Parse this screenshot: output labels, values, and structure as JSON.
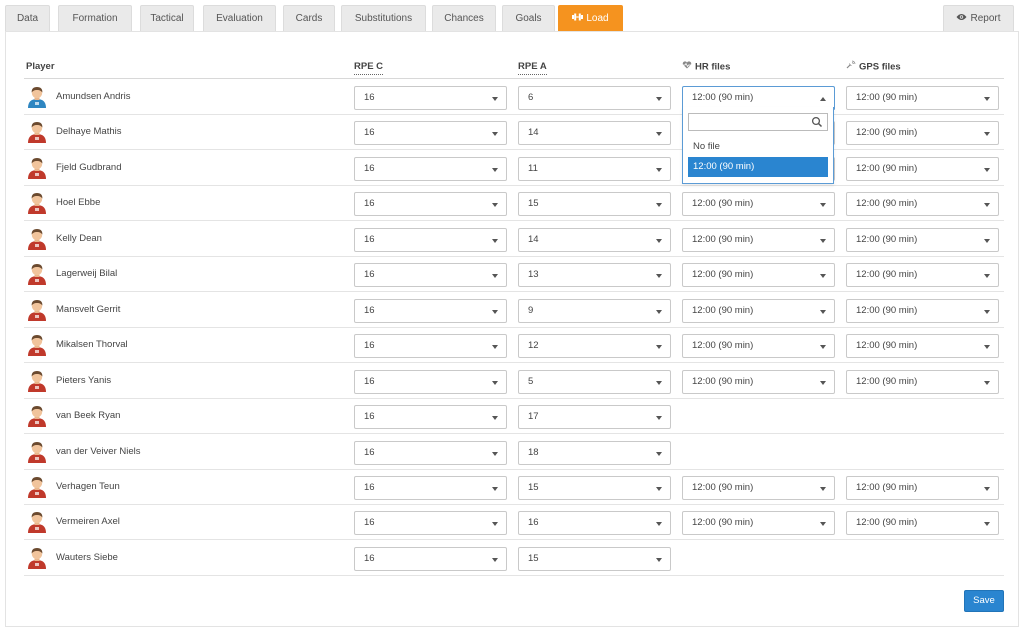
{
  "tabs": [
    {
      "label": "Data",
      "active": false
    },
    {
      "label": "Formation",
      "active": false
    },
    {
      "label": "Tactical",
      "active": false
    },
    {
      "label": "Evaluation",
      "active": false
    },
    {
      "label": "Cards",
      "active": false
    },
    {
      "label": "Substitutions",
      "active": false
    },
    {
      "label": "Chances",
      "active": false
    },
    {
      "label": "Goals",
      "active": false
    },
    {
      "label": "Load",
      "active": true,
      "icon": "dumbbell-icon"
    }
  ],
  "report_tab": {
    "label": "Report",
    "icon": "eye-icon"
  },
  "table": {
    "headers": {
      "player": "Player",
      "rpe_c": "RPE C",
      "rpe_a": "RPE A",
      "hr_files": "HR files",
      "gps_files": "GPS files"
    },
    "rows": [
      {
        "name": "Amundsen Andris",
        "rpe_c": "16",
        "rpe_a": "6",
        "hr": "12:00 (90 min)",
        "gps": "12:00 (90 min)",
        "avatar": "keeper"
      },
      {
        "name": "Delhaye Mathis",
        "rpe_c": "16",
        "rpe_a": "14",
        "hr": "12:00 (90 min)",
        "gps": "12:00 (90 min)",
        "avatar": "player"
      },
      {
        "name": "Fjeld Gudbrand",
        "rpe_c": "16",
        "rpe_a": "11",
        "hr": "12:00 (90 min)",
        "gps": "12:00 (90 min)",
        "avatar": "player"
      },
      {
        "name": "Hoel Ebbe",
        "rpe_c": "16",
        "rpe_a": "15",
        "hr": "12:00 (90 min)",
        "gps": "12:00 (90 min)",
        "avatar": "player"
      },
      {
        "name": "Kelly Dean",
        "rpe_c": "16",
        "rpe_a": "14",
        "hr": "12:00 (90 min)",
        "gps": "12:00 (90 min)",
        "avatar": "player"
      },
      {
        "name": "Lagerweij Bilal",
        "rpe_c": "16",
        "rpe_a": "13",
        "hr": "12:00 (90 min)",
        "gps": "12:00 (90 min)",
        "avatar": "player"
      },
      {
        "name": "Mansvelt Gerrit",
        "rpe_c": "16",
        "rpe_a": "9",
        "hr": "12:00 (90 min)",
        "gps": "12:00 (90 min)",
        "avatar": "player"
      },
      {
        "name": "Mikalsen Thorval",
        "rpe_c": "16",
        "rpe_a": "12",
        "hr": "12:00 (90 min)",
        "gps": "12:00 (90 min)",
        "avatar": "player"
      },
      {
        "name": "Pieters Yanis",
        "rpe_c": "16",
        "rpe_a": "5",
        "hr": "12:00 (90 min)",
        "gps": "12:00 (90 min)",
        "avatar": "player"
      },
      {
        "name": "van Beek Ryan",
        "rpe_c": "16",
        "rpe_a": "17",
        "hr": null,
        "gps": null,
        "avatar": "player"
      },
      {
        "name": "van der Veiver Niels",
        "rpe_c": "16",
        "rpe_a": "18",
        "hr": null,
        "gps": null,
        "avatar": "player"
      },
      {
        "name": "Verhagen Teun",
        "rpe_c": "16",
        "rpe_a": "15",
        "hr": "12:00 (90 min)",
        "gps": "12:00 (90 min)",
        "avatar": "player"
      },
      {
        "name": "Vermeiren Axel",
        "rpe_c": "16",
        "rpe_a": "16",
        "hr": "12:00 (90 min)",
        "gps": "12:00 (90 min)",
        "avatar": "player"
      },
      {
        "name": "Wauters Siebe",
        "rpe_c": "16",
        "rpe_a": "15",
        "hr": null,
        "gps": null,
        "avatar": "player"
      }
    ]
  },
  "hr_dropdown": {
    "open_row": 0,
    "search_value": "",
    "options": [
      {
        "label": "No file",
        "highlighted": false
      },
      {
        "label": "12:00 (90 min)",
        "highlighted": true
      }
    ]
  },
  "save_label": "Save",
  "colors": {
    "accent_tab": "#f5931f",
    "primary_button": "#2a85d0",
    "jersey_red": "#c0392b",
    "keeper_blue": "#2e86c1"
  }
}
